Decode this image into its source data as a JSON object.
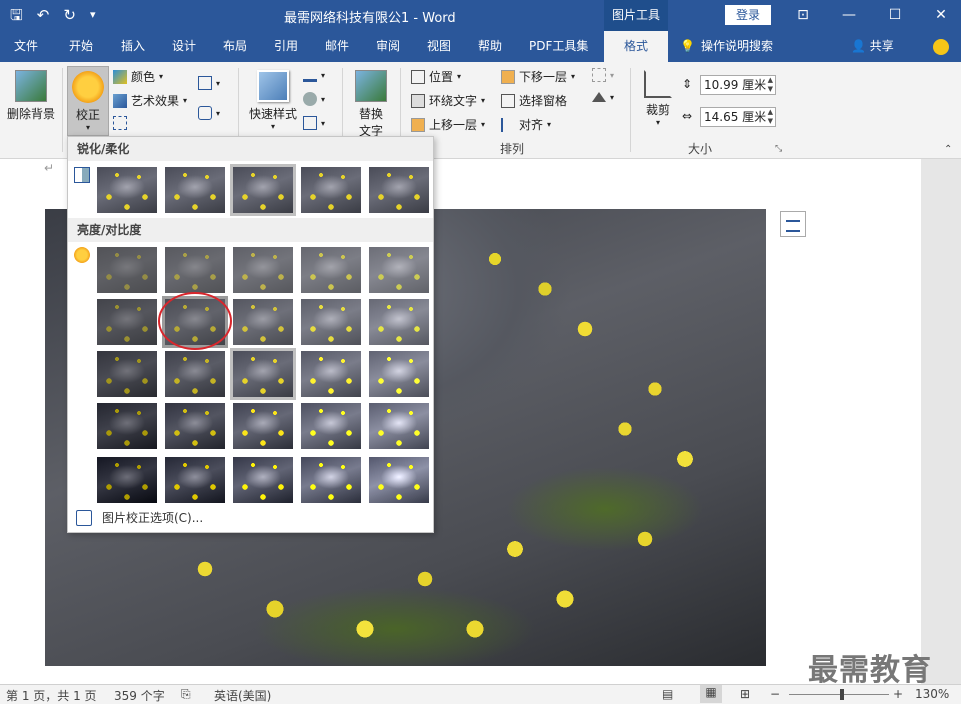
{
  "titlebar": {
    "qat": {
      "save_glyph": "🖫",
      "undo_glyph": "↶",
      "redo_glyph": "↻",
      "customize_glyph": "▾"
    },
    "title": "最需网络科技有限公1  -  Word",
    "context_tools": "图片工具",
    "login": "登录",
    "controls": {
      "ribbon_display": "⊡",
      "minimize": "—",
      "maximize": "☐",
      "close": "✕"
    }
  },
  "tabs": {
    "items": [
      "文件",
      "开始",
      "插入",
      "设计",
      "布局",
      "引用",
      "邮件",
      "审阅",
      "视图",
      "帮助",
      "PDF工具集"
    ],
    "active": "格式",
    "tell_me": "操作说明搜索",
    "share": "共享"
  },
  "ribbon": {
    "remove_bg": "删除背景",
    "corrections": "校正",
    "color": "颜色",
    "art_effects": "艺术效果",
    "quick_styles": "快速样式",
    "alt_text_line1": "替换",
    "alt_text_line2": "文字",
    "position": "位置",
    "wrap_text": "环绕文字",
    "bring_forward": "上移一层",
    "send_backward": "下移一层",
    "selection_pane": "选择窗格",
    "align": "对齐",
    "arrange_label": "排列",
    "crop": "裁剪",
    "size_label": "大小",
    "height_value": "10.99 厘米",
    "width_value": "14.65 厘米"
  },
  "dropdown": {
    "sharpen_header": "锐化/柔化",
    "brightness_header": "亮度/对比度",
    "footer": "图片校正选项(C)..."
  },
  "document": {
    "watermark": "最需教育"
  },
  "statusbar": {
    "page": "第 1 页，共 1 页",
    "words": "359 个字",
    "language": "英语(美国)",
    "zoom": "130%"
  },
  "colors": {
    "accent": "#2b579a",
    "highlight_circle": "#d9262c",
    "flower": "#e6d32a"
  }
}
